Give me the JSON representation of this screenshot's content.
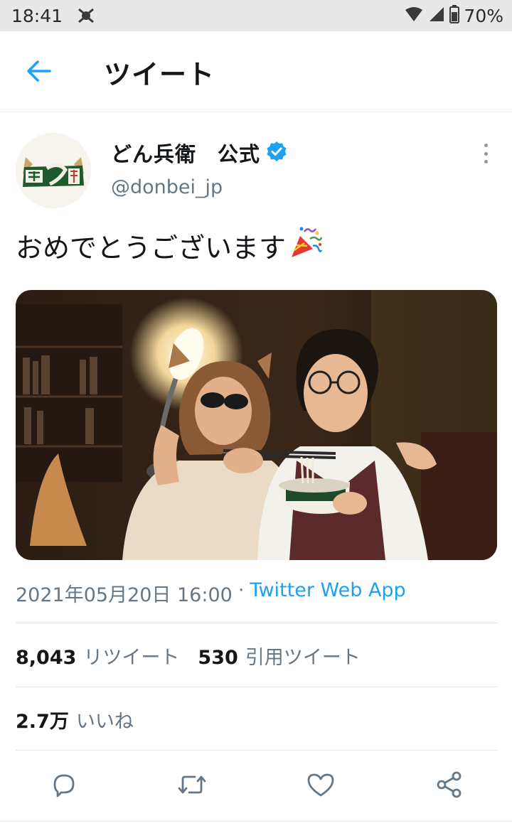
{
  "status_bar": {
    "time": "18:41",
    "battery": "70%",
    "icons": [
      "app-notification-icon",
      "signal-icon",
      "cellular-icon",
      "battery-icon"
    ]
  },
  "header": {
    "title": "ツイート",
    "back_icon": "arrow-left-icon"
  },
  "tweet": {
    "author": {
      "name": "どん兵衛　公式",
      "handle": "@donbei_jp",
      "verified": true
    },
    "text": "おめでとうございます",
    "emoji_icon": "party-popper-icon",
    "media": {
      "kind": "photo"
    },
    "timestamp": "2021年05月20日 16:00",
    "separator": "·",
    "source": "Twitter Web App",
    "retweets_count": "8,043",
    "retweets_label": "リツイート",
    "quotes_count": "530",
    "quotes_label": "引用ツイート",
    "likes_count": "2.7万",
    "likes_label": "いいね"
  },
  "actions": [
    "reply-icon",
    "retweet-icon",
    "like-icon",
    "share-icon"
  ],
  "colors": {
    "accent": "#1da1f2",
    "secondary_text": "#657786",
    "primary_text": "#14171a",
    "status_bar_bg": "#e8e8e8"
  }
}
